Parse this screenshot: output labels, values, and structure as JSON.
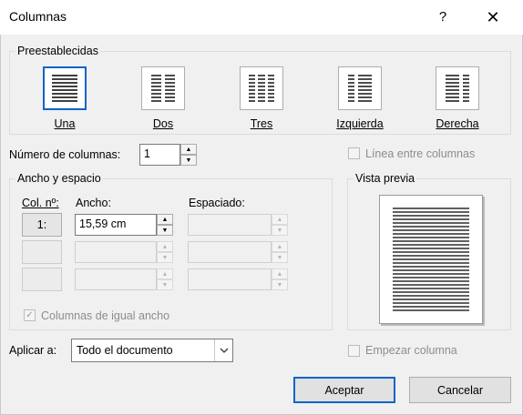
{
  "window": {
    "title": "Columnas",
    "help_glyph": "?",
    "close_glyph": "✕"
  },
  "presets": {
    "group_label": "Preestablecidas",
    "items": [
      {
        "label": "Una",
        "selected": true,
        "icon": "one-column-icon"
      },
      {
        "label": "Dos",
        "selected": false,
        "icon": "two-columns-icon"
      },
      {
        "label": "Tres",
        "selected": false,
        "icon": "three-columns-icon"
      },
      {
        "label": "Izquierda",
        "selected": false,
        "icon": "left-column-icon"
      },
      {
        "label": "Derecha",
        "selected": false,
        "icon": "right-column-icon"
      }
    ]
  },
  "num_columns": {
    "label": "Número de columnas:",
    "value": "1"
  },
  "line_between": {
    "label": "Línea entre columnas",
    "checked": false,
    "enabled": false
  },
  "width_spacing": {
    "group_label": "Ancho y espacio",
    "col_header": "Col. nº:",
    "width_header": "Ancho:",
    "spacing_header": "Espaciado:",
    "rows": [
      {
        "col": "1:",
        "width": "15,59 cm",
        "spacing": ""
      },
      {
        "col": "",
        "width": "",
        "spacing": ""
      },
      {
        "col": "",
        "width": "",
        "spacing": ""
      }
    ]
  },
  "equal_width": {
    "label": "Columnas de igual ancho",
    "checked": true,
    "enabled": false
  },
  "preview": {
    "group_label": "Vista previa"
  },
  "apply_to": {
    "label": "Aplicar a:",
    "value": "Todo el documento"
  },
  "start_column": {
    "label": "Empezar columna",
    "checked": false,
    "enabled": false
  },
  "buttons": {
    "ok": "Aceptar",
    "cancel": "Cancelar"
  },
  "colors": {
    "accent": "#0a64c8",
    "dialog_bg": "#f0f0f0",
    "disabled_text": "#8d8d8d"
  }
}
